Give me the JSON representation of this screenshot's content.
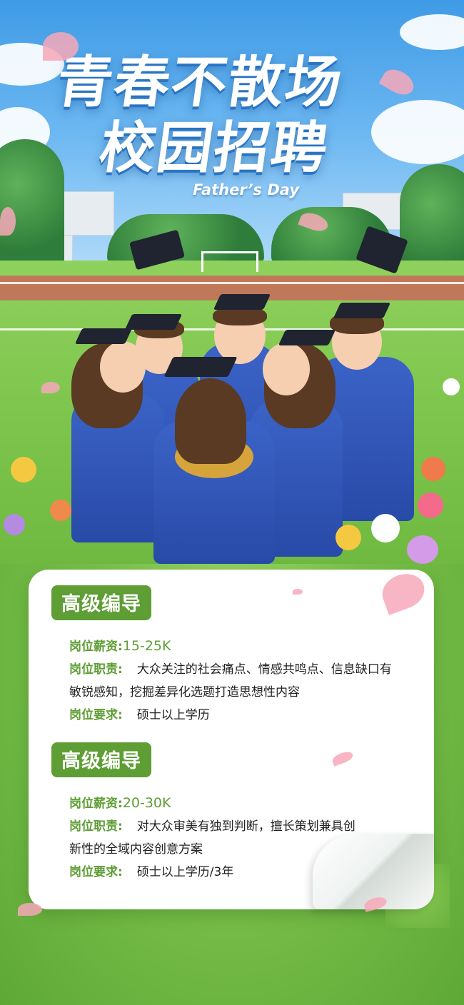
{
  "poster": {
    "title_line1": "青春不散场",
    "title_line2": "校园招聘",
    "subtitle": "Father’s Day"
  },
  "jobs": [
    {
      "title": "高级编导",
      "salary_label": "岗位薪资:",
      "salary": "15-25K",
      "duty_label": "岗位职责:",
      "duty_line1": "大众关注的社会痛点、情感共鸣点、信息缺口有",
      "duty_line2": "敏锐感知，挖掘差异化选题打造思想性内容",
      "req_label": "岗位要求:",
      "requirement": "硕士以上学历"
    },
    {
      "title": "高级编导",
      "salary_label": "岗位薪资:",
      "salary": "20-30K",
      "duty_label": "岗位职责:",
      "duty_line1": "对大众审美有独到判断，擅长策划兼具创",
      "duty_line2": "新性的全域内容创意方案",
      "req_label": "岗位要求:",
      "requirement": "硕士以上学历/3年"
    }
  ],
  "colors": {
    "accent_green": "#5e9e35",
    "sky_blue": "#3f9be6",
    "gown_blue": "#3b63c7"
  }
}
